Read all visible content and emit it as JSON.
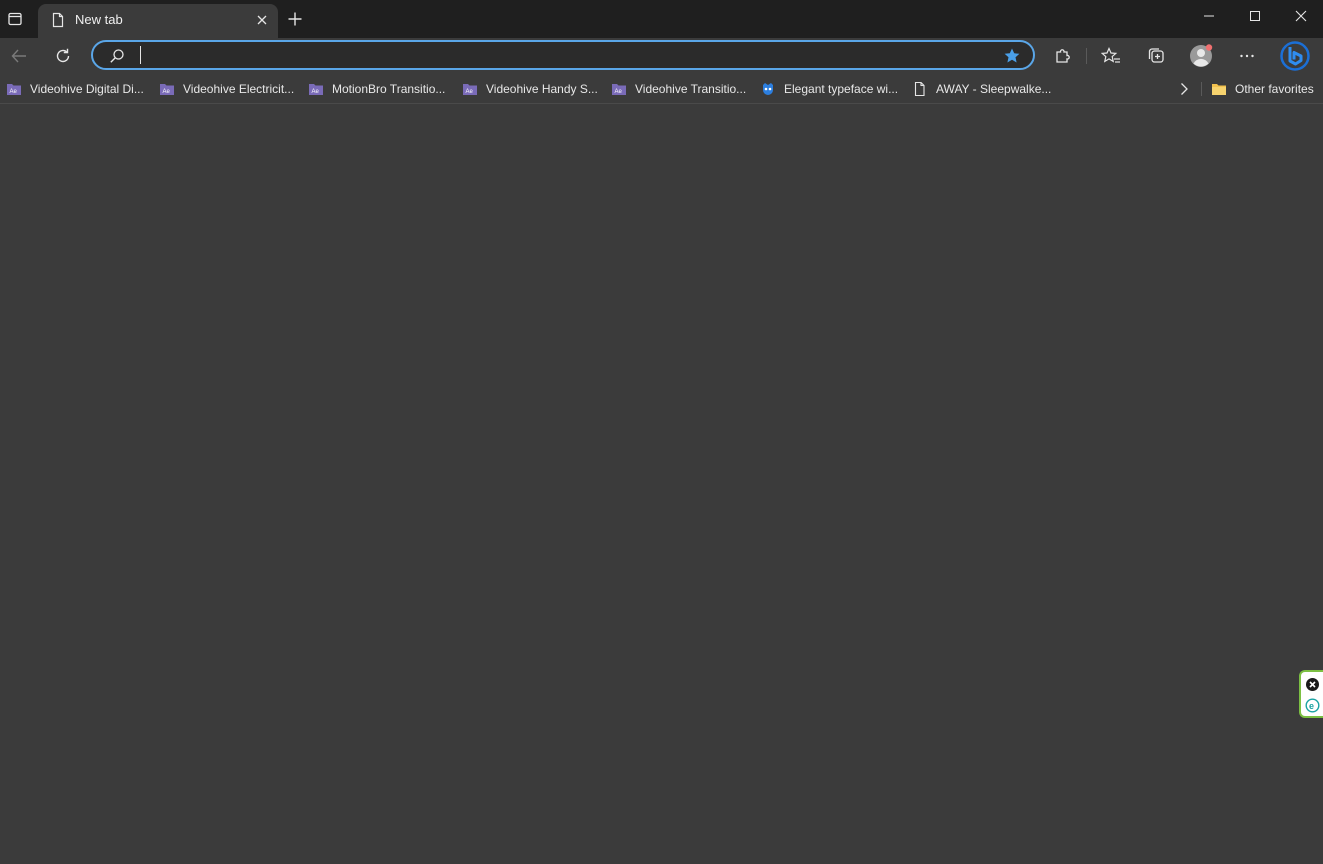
{
  "tab": {
    "title": "New tab"
  },
  "omnibox": {
    "value": "",
    "placeholder": ""
  },
  "bookmarks": {
    "items": [
      {
        "label": "Videohive Digital Di...",
        "icon": "ae-folder-icon"
      },
      {
        "label": "Videohive Electricit...",
        "icon": "ae-folder-icon"
      },
      {
        "label": "MotionBro Transitio...",
        "icon": "ae-folder-icon"
      },
      {
        "label": "Videohive Handy S...",
        "icon": "ae-folder-icon"
      },
      {
        "label": "Videohive Transitio...",
        "icon": "ae-folder-icon"
      },
      {
        "label": "Elegant typeface wi...",
        "icon": "blue-mask-icon"
      },
      {
        "label": "AWAY - Sleepwalke...",
        "icon": "page-icon"
      }
    ],
    "other_favorites": "Other favorites"
  },
  "colors": {
    "omnibox_border": "#5aa6e8",
    "star": "#4a9fe8",
    "bing": "#1b6fd6",
    "widget_border": "#7cc043",
    "widget_logo": "#1aa3a3"
  }
}
